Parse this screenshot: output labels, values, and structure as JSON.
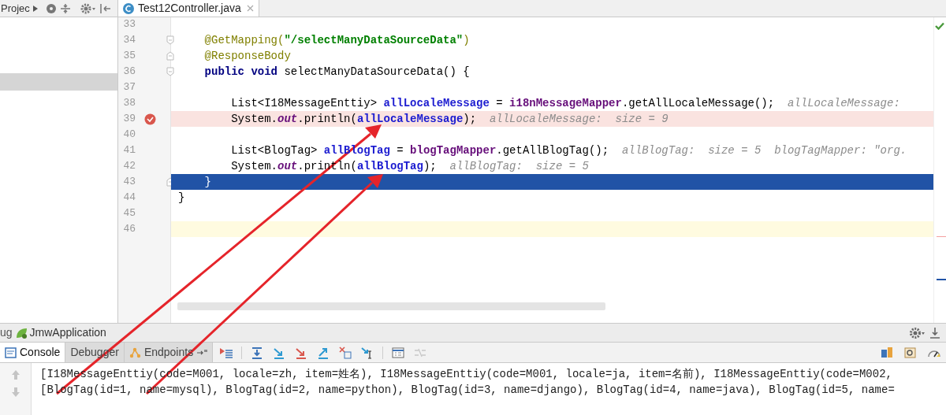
{
  "project_panel": {
    "title": "Projec"
  },
  "editor": {
    "tab": {
      "label": "Test12Controller.java",
      "selected": true
    },
    "lines": [
      {
        "number": "33"
      },
      {
        "number": "34",
        "fold_start": true,
        "tokens": [
          {
            "kind": "annotation",
            "text": "    @GetMapping("
          },
          {
            "kind": "string",
            "text": "\"/selectManyDataSourceData\""
          },
          {
            "kind": "annotation",
            "text": ")"
          }
        ]
      },
      {
        "number": "35",
        "fold_end": true,
        "tokens": [
          {
            "kind": "annotation",
            "text": "    @ResponseBody"
          }
        ]
      },
      {
        "number": "36",
        "fold_start": true,
        "tokens": [
          {
            "kind": "keyword",
            "text": "    public void"
          },
          {
            "kind": "plain",
            "text": " selectManyDataSourceData() {"
          }
        ]
      },
      {
        "number": "37"
      },
      {
        "number": "38",
        "tokens": [
          {
            "kind": "plain",
            "text": "        List<I18MessageEnttiy> "
          },
          {
            "kind": "local",
            "text": "allLocaleMessage"
          },
          {
            "kind": "plain",
            "text": " = "
          },
          {
            "kind": "member",
            "text": "i18nMessageMapper"
          },
          {
            "kind": "plain",
            "text": ".getAllLocaleMessage();  "
          },
          {
            "kind": "hint",
            "text": "allLocaleMessage:"
          }
        ]
      },
      {
        "number": "39",
        "breakpoint": true,
        "tokens": [
          {
            "kind": "plain",
            "text": "        System."
          },
          {
            "kind": "static",
            "text": "out"
          },
          {
            "kind": "plain",
            "text": ".println("
          },
          {
            "kind": "local",
            "text": "allLocaleMessage"
          },
          {
            "kind": "plain",
            "text": ");  "
          },
          {
            "kind": "hint",
            "text": "allLocaleMessage:  size = 9"
          }
        ]
      },
      {
        "number": "40"
      },
      {
        "number": "41",
        "tokens": [
          {
            "kind": "plain",
            "text": "        List<BlogTag> "
          },
          {
            "kind": "local",
            "text": "allBlogTag"
          },
          {
            "kind": "plain",
            "text": " = "
          },
          {
            "kind": "member",
            "text": "blogTagMapper"
          },
          {
            "kind": "plain",
            "text": ".getAllBlogTag();  "
          },
          {
            "kind": "hint",
            "text": "allBlogTag:  size = 5  blogTagMapper: \"org."
          }
        ]
      },
      {
        "number": "42",
        "tokens": [
          {
            "kind": "plain",
            "text": "        System."
          },
          {
            "kind": "static",
            "text": "out"
          },
          {
            "kind": "plain",
            "text": ".println("
          },
          {
            "kind": "local",
            "text": "allBlogTag"
          },
          {
            "kind": "plain",
            "text": ");  "
          },
          {
            "kind": "hint",
            "text": "allBlogTag:  size = 5"
          }
        ]
      },
      {
        "number": "43",
        "current_line": true,
        "fold_end": true,
        "tokens": [
          {
            "kind": "plain",
            "text": "    }"
          }
        ]
      },
      {
        "number": "44",
        "tokens": [
          {
            "kind": "plain",
            "text": "}"
          }
        ]
      },
      {
        "number": "45"
      },
      {
        "number": "46",
        "caret_line": true
      }
    ]
  },
  "debug_panel": {
    "title": "ug",
    "config": "JmwApplication",
    "tabs": [
      {
        "label": "Console",
        "selected": true
      },
      {
        "label": "Debugger",
        "selected": false
      },
      {
        "label": "Endpoints",
        "selected": false
      }
    ],
    "console_lines": [
      "[I18MessageEnttiy(code=M001, locale=zh, item=姓名), I18MessageEnttiy(code=M001, locale=ja, item=名前), I18MessageEnttiy(code=M002,",
      "[BlogTag(id=1, name=mysql), BlogTag(id=2, name=python), BlogTag(id=3, name=django), BlogTag(id=4, name=java), BlogTag(id=5, name="
    ]
  }
}
